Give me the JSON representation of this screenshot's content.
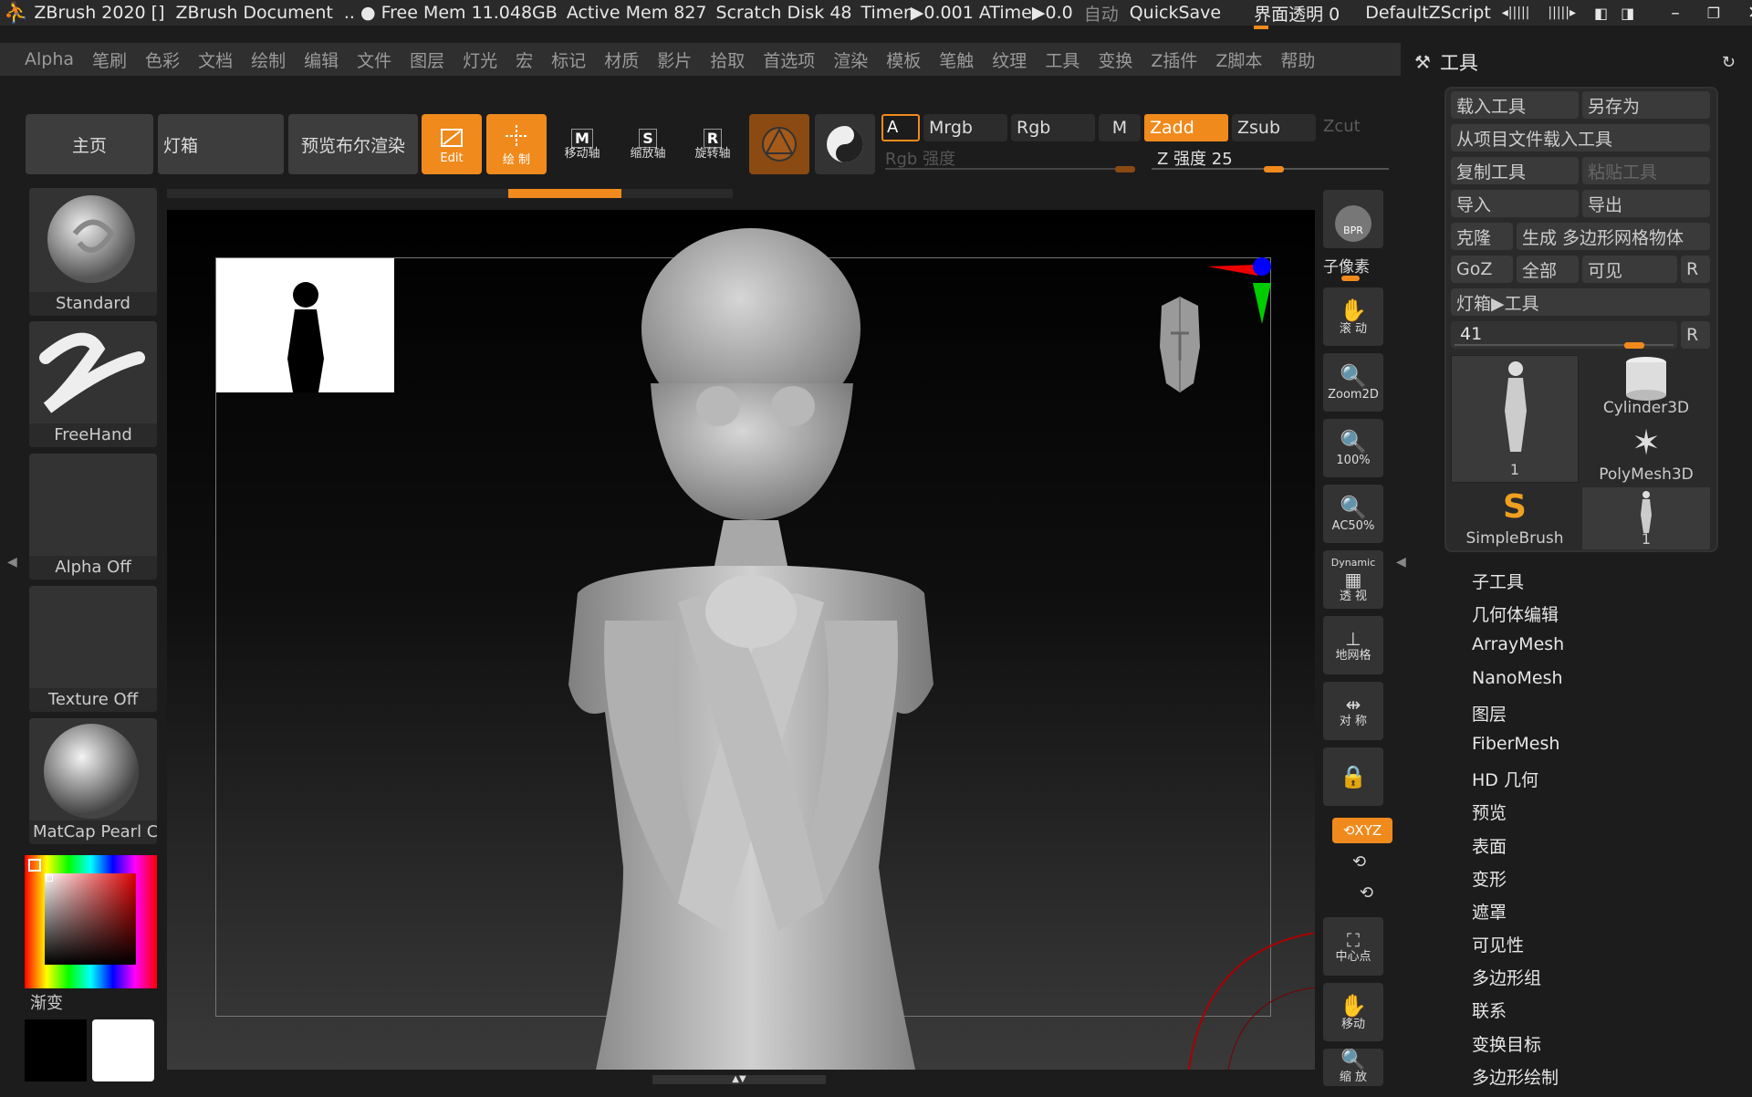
{
  "titlebar": {
    "app": "ZBrush 2020 []",
    "doc": "ZBrush Document",
    "freemem": ".. ● Free Mem 11.048GB",
    "activemem": "Active Mem 827",
    "scratch": "Scratch Disk 48",
    "timer": "Timer▶0.001 ATime▶0.0",
    "auto": "自动",
    "quicksave": "QuickSave",
    "transparency": "界面透明 0",
    "zscript": "DefaultZScript"
  },
  "menu": [
    "Alpha",
    "笔刷",
    "色彩",
    "文档",
    "绘制",
    "编辑",
    "文件",
    "图层",
    "灯光",
    "宏",
    "标记",
    "材质",
    "影片",
    "拾取",
    "首选项",
    "渲染",
    "模板",
    "笔触",
    "纹理",
    "工具",
    "变换",
    "Z插件",
    "Z脚本",
    "帮助"
  ],
  "toolbar": {
    "home": "主页",
    "lightbox": "灯箱",
    "bpr_preview": "预览布尔渲染",
    "edit": "Edit",
    "draw": "绘 制",
    "move": "移动轴",
    "scale": "缩放轴",
    "rotate": "旋转轴",
    "a": "A",
    "mrgb": "Mrgb",
    "rgb": "Rgb",
    "m": "M",
    "zadd": "Zadd",
    "zsub": "Zsub",
    "zcut": "Zcut",
    "rgb_intensity": "Rgb 强度",
    "z_intensity": "Z 强度 25"
  },
  "left": {
    "brush": "Standard",
    "stroke": "FreeHand",
    "alpha": "Alpha Off",
    "texture": "Texture Off",
    "material": "MatCap Pearl Ca",
    "gradient": "渐变",
    "colors": {
      "main": "#000000",
      "secondary": "#ffffff"
    }
  },
  "rightshelf": {
    "bpr": "BPR",
    "subpixel": "子像素",
    "scroll": "滚 动",
    "zoom2d": "Zoom2D",
    "p100": "100%",
    "ac50": "AC50%",
    "dynamic": "Dynamic",
    "persp": "透 视",
    "floor": "地网格",
    "sym": "对 称",
    "xyz": "XYZ",
    "center": "中心点",
    "move": "移动",
    "zoom": "缩 放"
  },
  "toolpanel": {
    "title": "工具",
    "load": "载入工具",
    "saveas": "另存为",
    "loadproj": "从项目文件载入工具",
    "copy": "复制工具",
    "paste": "粘贴工具",
    "import": "导入",
    "export": "导出",
    "clone": "克隆",
    "makepoly": "生成 多边形网格物体",
    "goz": "GoZ",
    "all": "全部",
    "visible": "可见",
    "r": "R",
    "lightboxtool": "灯箱▶工具",
    "count": "41",
    "thumbs": [
      "1",
      "Cylinder3D",
      "PolyMesh3D",
      "SimpleBrush",
      "1"
    ],
    "subpalettes": [
      "子工具",
      "几何体编辑",
      "ArrayMesh",
      "NanoMesh",
      "图层",
      "FiberMesh",
      "HD 几何",
      "预览",
      "表面",
      "变形",
      "遮罩",
      "可见性",
      "多边形组",
      "联系",
      "变换目标",
      "多边形绘制"
    ]
  }
}
